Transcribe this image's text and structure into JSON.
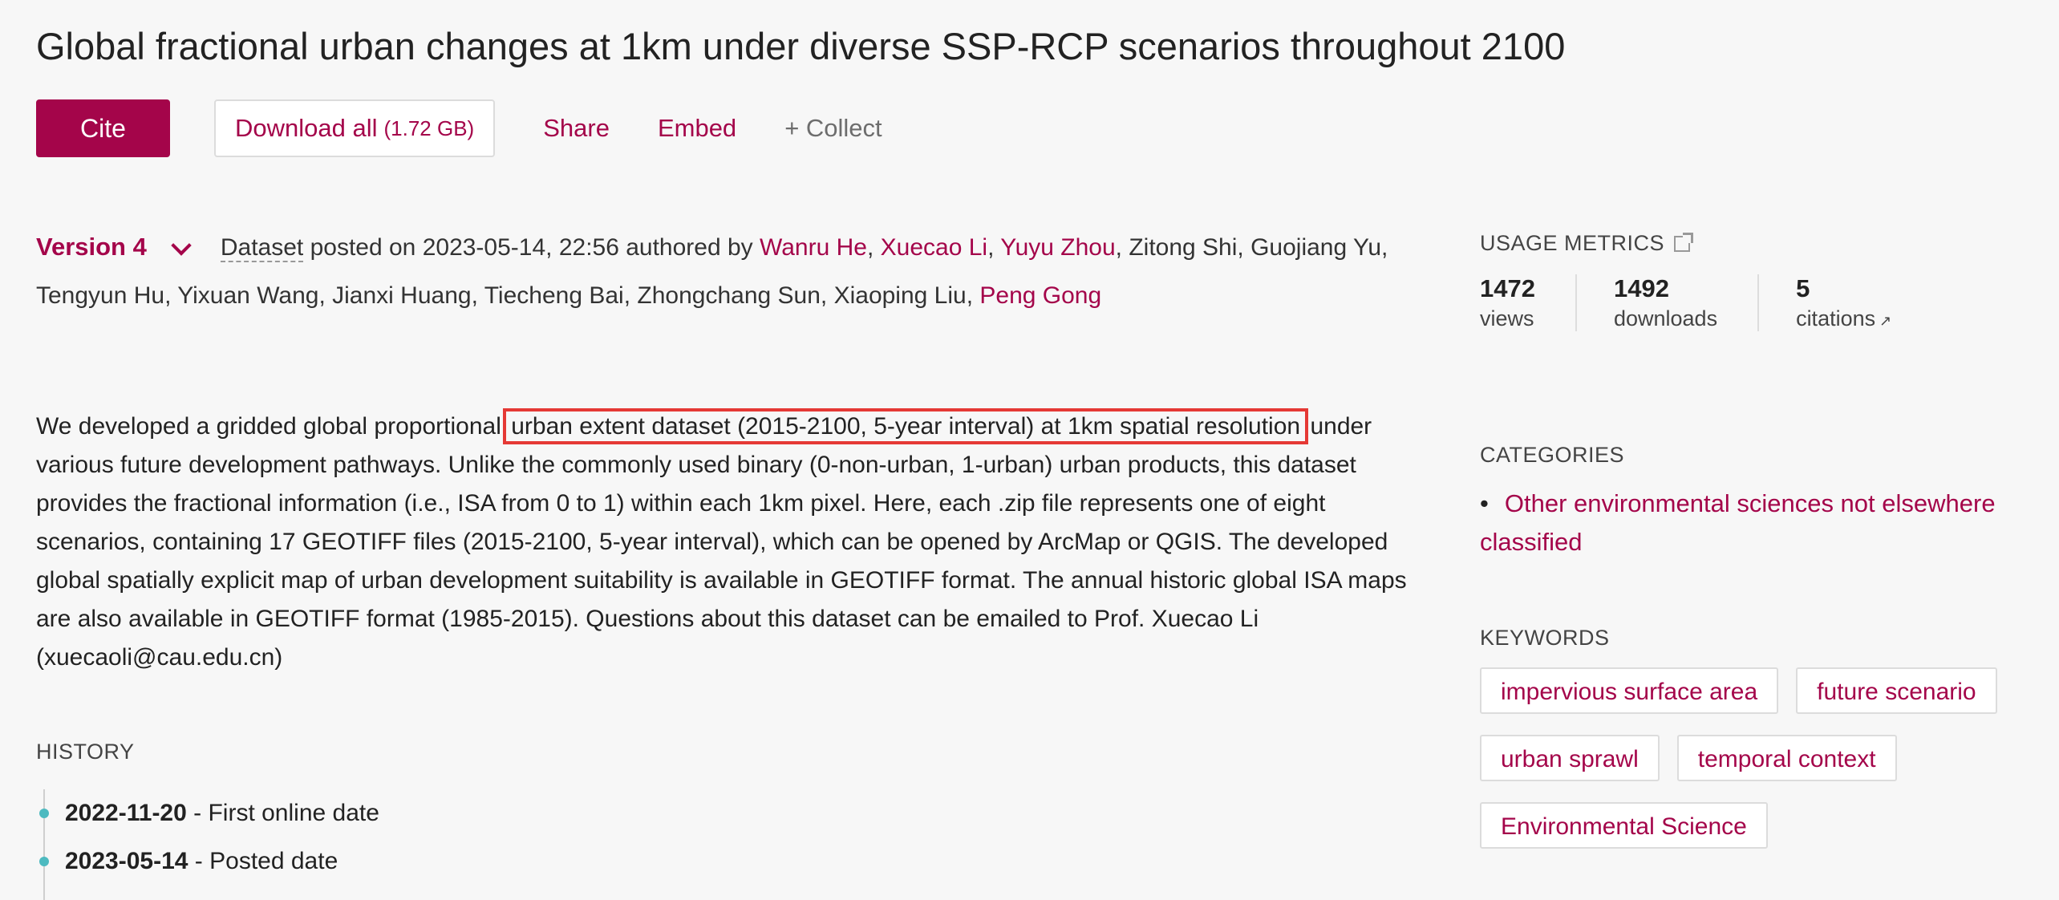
{
  "title": "Global fractional urban changes at 1km under diverse SSP-RCP scenarios throughout 2100",
  "toolbar": {
    "cite": "Cite",
    "download": "Download all",
    "download_size": "(1.72 GB)",
    "share": "Share",
    "embed": "Embed",
    "collect": "+ Collect"
  },
  "meta": {
    "version": "Version 4",
    "dataset_word": "Dataset",
    "posted": " posted on 2023-05-14, 22:56 authored by ",
    "authors": [
      {
        "name": "Wanru He",
        "linked": true
      },
      {
        "name": "Xuecao Li",
        "linked": true
      },
      {
        "name": "Yuyu Zhou",
        "linked": true
      },
      {
        "name": "Zitong Shi",
        "linked": false
      },
      {
        "name": "Guojiang Yu",
        "linked": false
      },
      {
        "name": "Tengyun Hu",
        "linked": false
      },
      {
        "name": "Yixuan Wang",
        "linked": false
      },
      {
        "name": "Jianxi Huang",
        "linked": false
      },
      {
        "name": "Tiecheng Bai",
        "linked": false
      },
      {
        "name": "Zhongchang Sun",
        "linked": false
      },
      {
        "name": "Xiaoping Liu",
        "linked": false
      },
      {
        "name": "Peng Gong",
        "linked": true
      }
    ]
  },
  "description": {
    "before": "We developed a gridded global proportional ",
    "highlight": "urban extent dataset (2015-2100, 5-year interval) at 1km spatial resolution",
    "after": " under various future development pathways. Unlike the commonly used binary (0-non-urban, 1-urban) urban products, this dataset provides the fractional information (i.e., ISA from 0 to 1) within each 1km pixel. Here, each .zip file represents one of eight scenarios, containing 17 GEOTIFF files (2015-2100, 5-year interval), which can be opened by ArcMap or QGIS. The developed global spatially explicit map of urban development suitability is available in GEOTIFF format. The annual historic global ISA maps are also available in GEOTIFF format (1985-2015). Questions about this dataset can be emailed to Prof. Xuecao Li (xuecaoli@cau.edu.cn)"
  },
  "history": {
    "heading": "HISTORY",
    "items": [
      {
        "date": "2022-11-20",
        "label": " - First online date"
      },
      {
        "date": "2023-05-14",
        "label": " - Posted date"
      }
    ]
  },
  "usage": {
    "heading": "USAGE METRICS",
    "metrics": [
      {
        "value": "1472",
        "label": "views"
      },
      {
        "value": "1492",
        "label": "downloads"
      },
      {
        "value": "5",
        "label": "citations"
      }
    ]
  },
  "categories": {
    "heading": "CATEGORIES",
    "items": [
      "Other environmental sciences not elsewhere classified"
    ]
  },
  "keywords": {
    "heading": "KEYWORDS",
    "items": [
      "impervious surface area",
      "future scenario",
      "urban sprawl",
      "temporal context",
      "Environmental Science"
    ]
  },
  "colors": {
    "accent": "#a4054a",
    "highlight_border": "#e53935",
    "timeline_dot": "#4dbac0"
  }
}
